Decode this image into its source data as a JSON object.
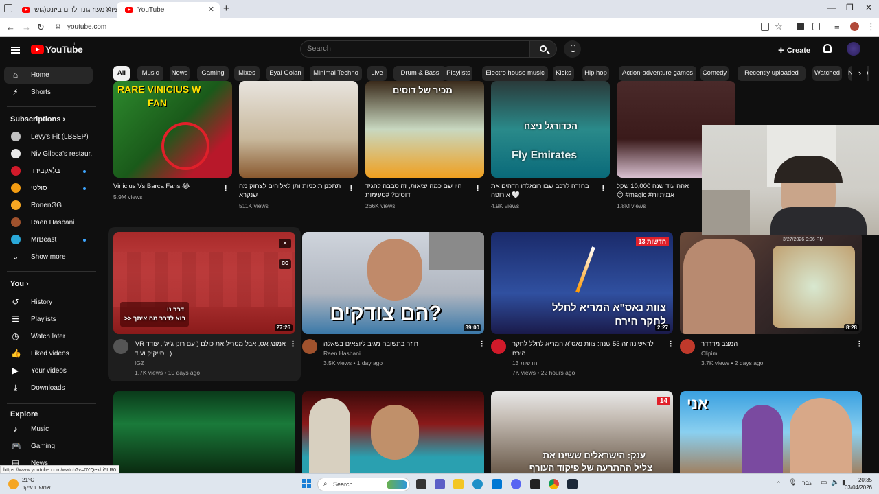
{
  "browser": {
    "tabs": [
      {
        "title": "מדעיות מעוז גונד לרים ביזנס(גוש",
        "active": false
      },
      {
        "title": "YouTube",
        "active": true
      }
    ],
    "url": "youtube.com",
    "status_url": "https://www.youtube.com/watch?v=0YQekhi5LR0"
  },
  "header": {
    "logo_text": "YouTube",
    "logo_region": "IL",
    "search_placeholder": "Search",
    "create_label": "Create"
  },
  "sidebar": {
    "main": [
      {
        "label": "Home",
        "icon": "home-icon",
        "active": true
      },
      {
        "label": "Shorts",
        "icon": "shorts-icon",
        "active": false
      }
    ],
    "subscriptions_title": "Subscriptions",
    "subscriptions": [
      {
        "label": "Levy's Fit (LBSEP)",
        "color": "#c0c0c0",
        "dot": false
      },
      {
        "label": "Niv Gilboa's restaur...",
        "color": "#e8e8e8",
        "dot": false
      },
      {
        "label": "בלאקבירד",
        "color": "#d11a2a",
        "dot": true
      },
      {
        "label": "סולטי",
        "color": "#f39c12",
        "dot": true
      },
      {
        "label": "RonenGG",
        "color": "#f5a623",
        "dot": false
      },
      {
        "label": "Raen Hasbani",
        "color": "#a0522d",
        "dot": false
      },
      {
        "label": "MrBeast",
        "color": "#2aa8d8",
        "dot": true
      }
    ],
    "show_more": "Show more",
    "you_title": "You",
    "you": [
      {
        "label": "History",
        "icon": "history-icon"
      },
      {
        "label": "Playlists",
        "icon": "playlists-icon"
      },
      {
        "label": "Watch later",
        "icon": "watch-later-icon"
      },
      {
        "label": "Liked videos",
        "icon": "like-icon"
      },
      {
        "label": "Your videos",
        "icon": "your-videos-icon"
      },
      {
        "label": "Downloads",
        "icon": "download-icon"
      }
    ],
    "explore_title": "Explore",
    "explore": [
      {
        "label": "Music",
        "icon": "music-icon"
      },
      {
        "label": "Gaming",
        "icon": "gaming-icon"
      },
      {
        "label": "News",
        "icon": "news-icon"
      }
    ]
  },
  "chips": [
    "All",
    "Music",
    "News",
    "Gaming",
    "Mixes",
    "Eyal Golan",
    "Minimal Techno",
    "Live",
    "Drum & Bass",
    "Playlists",
    "Electro house music",
    "Kicks",
    "Hip hop",
    "Action-adventure games",
    "Comedy",
    "Recently uploaded",
    "Watched",
    "New to you"
  ],
  "row1": [
    {
      "title": "Vinicius Vs Barca Fans 😂",
      "title2": "",
      "meta": "5.9M views",
      "thumb_text": "RARE VINICIUS W FAN"
    },
    {
      "title": "תתכנן תוכניות ותן לאלוהים לצחוק מה",
      "title2": "שנקרא",
      "meta": "511K views",
      "thumb_text": ""
    },
    {
      "title": "היו שם כמה יציאות, זה סבבה להגיד",
      "title2": "דוסים? #טעימות",
      "meta": "266K views",
      "thumb_text": "מכיר של דוסים"
    },
    {
      "title": "בחזרה לרכב שבו רונאלדו הדהים את",
      "title2": "אירופה 🤍",
      "meta": "4.9K views",
      "thumb_text": "הכדורגל ניצח"
    },
    {
      "title": "אהה עוד שנה 10,000 שקל",
      "title2": "😌 #magic #אמיתיות",
      "meta": "1.8M views",
      "thumb_text": ""
    }
  ],
  "row2": [
    {
      "title": "אמונג אס, אבל מטריל את כולם ( עם רונן ג'יג'י, עודד SVR",
      "title2": "סייקיק ועוד...)",
      "channel": "IGZ",
      "meta": "1.7K views • 10 days ago",
      "duration": "27:26",
      "thumb_text": "דבר נו\n>> בוא לדבר מה איתך"
    },
    {
      "title": "חוזר בתשובה מגיב ליוצאים בשאלה",
      "title2": "",
      "channel": "Raen Hasbani",
      "meta": "3.5K views • 1 day ago",
      "duration": "39:00",
      "thumb_text": "הם צודקים?"
    },
    {
      "title": "לראשונה זה 53 שנה: צוות נאס\"א המריא לחלל לחקר",
      "title2": "הירח",
      "channel": "חדשות 13",
      "meta": "7K views • 22 hours ago",
      "duration": "2:27",
      "thumb_text": "צוות נאס\"א המריא לחלל לחקר הירח",
      "badge": "חדשות 13"
    },
    {
      "title": "המצב מדרדר",
      "title2": "",
      "channel": "Clipim",
      "meta": "3.7K views • 2 days ago",
      "duration": "8:28",
      "thumb_text": "",
      "stamp": "3/27/2026 9:06 PM"
    }
  ],
  "row3": [
    {
      "thumb_text": ""
    },
    {
      "thumb_text": ""
    },
    {
      "thumb_text": "ענק: הישראלים ששינו את צליל ההתרעה של פיקוד העורף",
      "badge": "14"
    },
    {
      "thumb_text": "אני"
    }
  ],
  "taskbar": {
    "weather_temp": "21°C",
    "weather_desc": "שמשי בעיקר",
    "search_label": "Search",
    "lang": "עבר",
    "time": "20:35",
    "date": "03/04/2026"
  },
  "colors": {
    "accent": "#ff0000",
    "bg": "#0f0f0f",
    "chip": "#272727"
  }
}
